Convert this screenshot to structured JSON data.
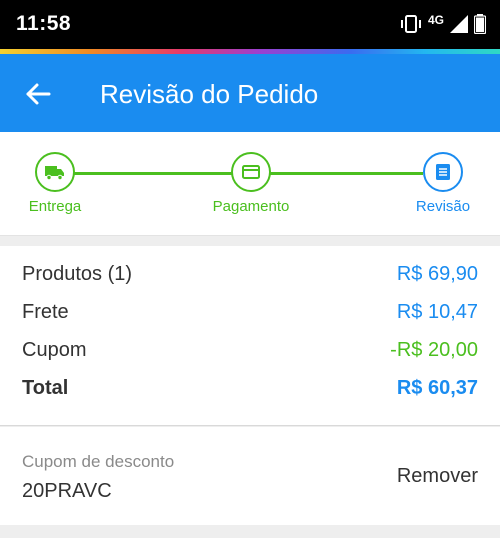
{
  "status_bar": {
    "time": "11:58",
    "network": "4G",
    "battery": "78"
  },
  "colors": {
    "primary": "#1a8cf0",
    "success": "#4bbf1f",
    "text": "#333333"
  },
  "header": {
    "title": "Revisão do Pedido",
    "back_icon": "arrow-left-icon"
  },
  "stepper": {
    "steps": [
      {
        "label": "Entrega",
        "icon": "truck-icon",
        "state": "done"
      },
      {
        "label": "Pagamento",
        "icon": "credit-card-icon",
        "state": "done"
      },
      {
        "label": "Revisão",
        "icon": "receipt-icon",
        "state": "active"
      }
    ]
  },
  "summary": {
    "rows": [
      {
        "label": "Produtos (1)",
        "value": "R$ 69,90"
      },
      {
        "label": "Frete",
        "value": "R$ 10,47"
      },
      {
        "label": "Cupom",
        "value": "-R$ 20,00"
      },
      {
        "label": "Total",
        "value": "R$ 60,37"
      }
    ]
  },
  "coupon": {
    "label": "Cupom de desconto",
    "code": "20PRAVC",
    "remove_label": "Remover"
  }
}
